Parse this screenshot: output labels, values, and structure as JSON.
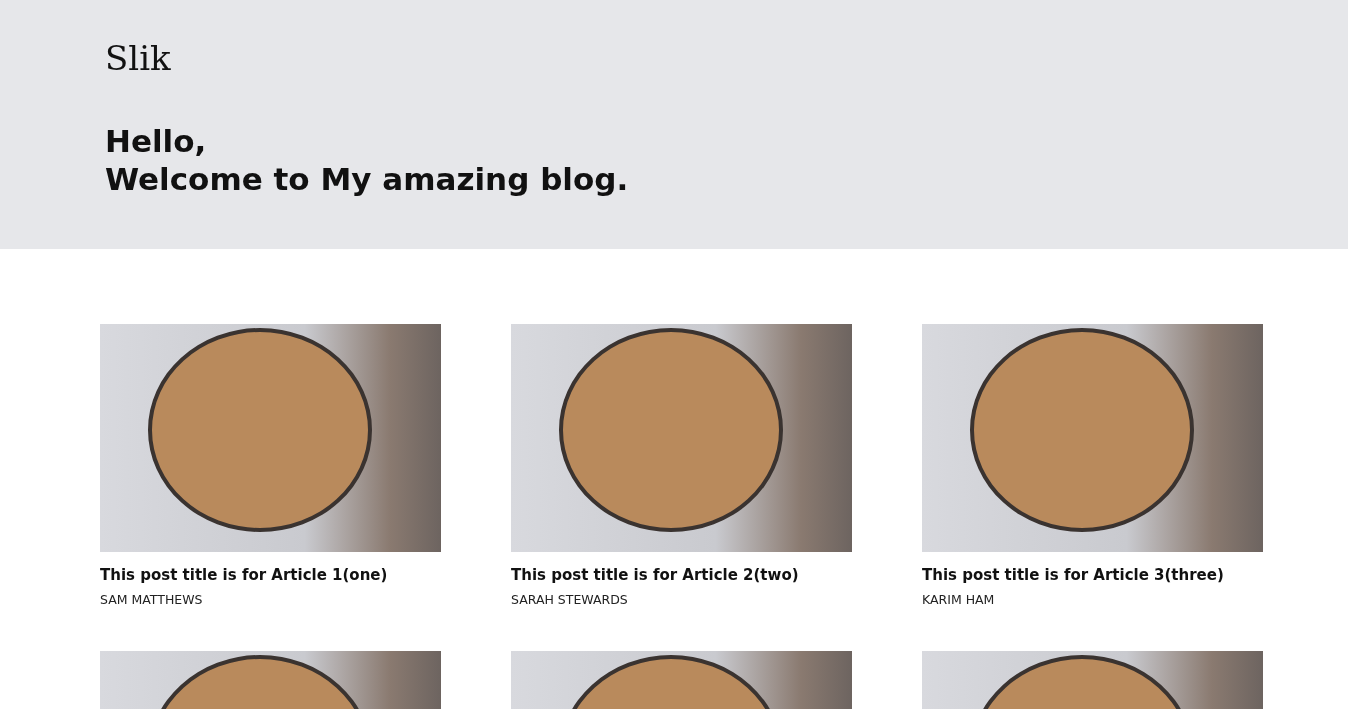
{
  "header": {
    "logo": "Slik",
    "greeting": [
      "Hello,",
      "Welcome to My amazing blog."
    ]
  },
  "posts": [
    {
      "kind": "full",
      "title": "This post title is for Article 1(one)",
      "author": "SAM MATTHEWS"
    },
    {
      "kind": "full",
      "title": "This post title is for Article 2(two)",
      "author": "SARAH STEWARDS"
    },
    {
      "kind": "full",
      "title": "This post title is for Article 3(three)",
      "author": "KARIM HAM"
    },
    {
      "kind": "cut"
    },
    {
      "kind": "cut"
    },
    {
      "kind": "cut"
    }
  ]
}
